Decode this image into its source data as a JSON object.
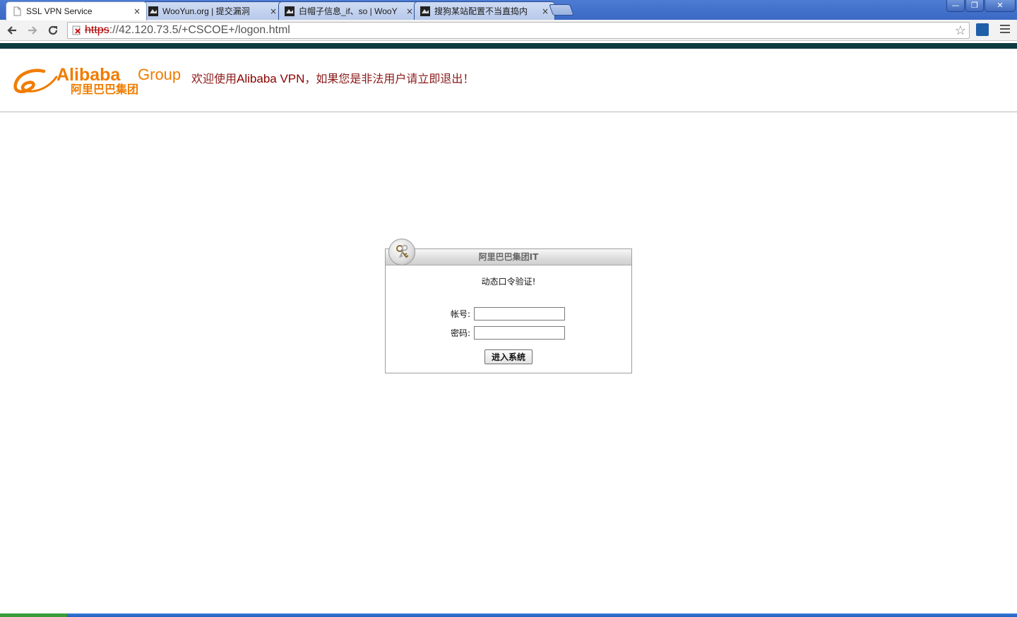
{
  "browser": {
    "tabs": [
      {
        "label": "SSL VPN Service",
        "active": true
      },
      {
        "label": "WooYun.org | 提交漏洞",
        "active": false
      },
      {
        "label": "白帽子信息_if、so | WooY",
        "active": false
      },
      {
        "label": "搜狗某站配置不当直捣内",
        "active": false
      }
    ],
    "tab_close_glyph": "×",
    "window_controls": {
      "minimize": "—",
      "restore": "❐",
      "close": "✕"
    },
    "address_scheme": "https",
    "address_rest": "://42.120.73.5/+CSCOE+/logon.html"
  },
  "header": {
    "logo_brand": "Alibaba",
    "logo_group": "Group",
    "logo_cn": "阿里巴巴集团",
    "welcome_prefix": "欢迎使用",
    "welcome_brand": "Alibaba VPN",
    "welcome_suffix": "，如果您是非法用户请立即退出！"
  },
  "login": {
    "title": "阿里巴巴集团IT",
    "subtitle": "动态口令验证!",
    "username_label": "帐号:",
    "password_label": "密码:",
    "username_value": "",
    "password_value": "",
    "submit_label": "进入系统"
  },
  "colors": {
    "brand_orange": "#f07c00",
    "welcome_red": "#8b1a1a",
    "tabbar_blue": "#3a68c4",
    "header_band": "#0b3a40"
  }
}
